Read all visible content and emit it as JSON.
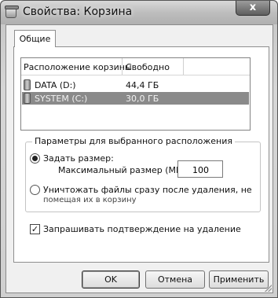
{
  "window": {
    "title": "Свойства: Корзина",
    "close_symbol": "x"
  },
  "tabs": [
    {
      "label": "Общие",
      "active": true
    }
  ],
  "locations": {
    "columns": [
      "Расположение корзины",
      "Свободно"
    ],
    "rows": [
      {
        "location": "DATA (D:)",
        "free": "44,4 ГБ",
        "selected": false
      },
      {
        "location": "SYSTEM (C:)",
        "free": "30,0 ГБ",
        "selected": true
      }
    ]
  },
  "settings": {
    "group_title": "Параметры для выбранного расположения",
    "custom_size_label": "Задать размер:",
    "custom_size_selected": true,
    "max_size_label": "Максимальный размер (МБ):",
    "max_size_value": "100",
    "delete_immediately_line1": "Уничтожать файлы сразу после удаления, не",
    "delete_immediately_line2": "помещая их в корзину",
    "delete_immediately_selected": false
  },
  "confirm": {
    "label": "Запрашивать подтверждение на удаление",
    "checked": true,
    "check_symbol": "✓"
  },
  "buttons": {
    "ok": "OK",
    "cancel": "Отмена",
    "apply": "Применить"
  },
  "icons": {
    "app": "recycle-bin-icon",
    "drive": "drive-icon",
    "close": "close-icon"
  }
}
